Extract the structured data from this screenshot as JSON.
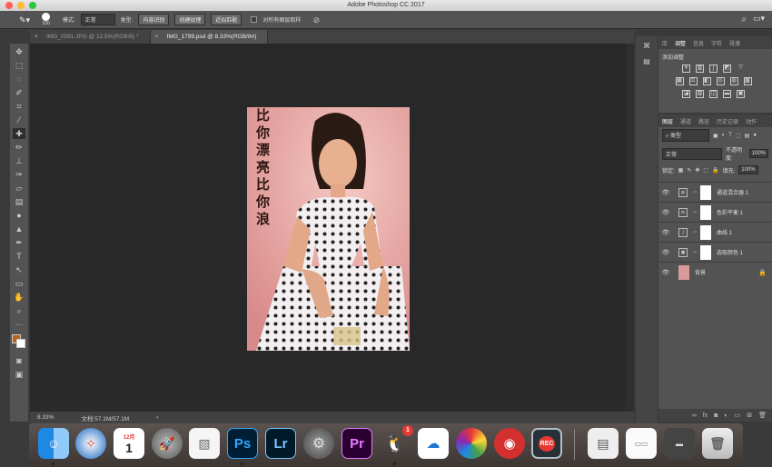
{
  "window": {
    "title": "Adobe Photoshop CC 2017"
  },
  "options": {
    "brush_size": "100",
    "mode_label": "模式:",
    "mode_value": "正常",
    "type_label": "类型:",
    "btn_content_aware": "内容识别",
    "btn_create_texture": "创建纹理",
    "btn_proximity_match": "近似匹配",
    "sample_all_layers": "对所有图层取样"
  },
  "tabs": [
    {
      "label": "IMG_0591.JPG @ 12.5%(RGB/8) *"
    },
    {
      "label": "IMG_1799.psd @ 8.33%(RGB/8#)"
    }
  ],
  "photo": {
    "text_lines": [
      "比",
      "你",
      "漂",
      "亮",
      "比",
      "你",
      "浪"
    ]
  },
  "status": {
    "zoom": "8.33%",
    "doc": "文档:57.1M/57.1M"
  },
  "right_panel": {
    "top_tabs": [
      "库",
      "调整",
      "信息",
      "字符",
      "段落"
    ],
    "adjustments_title": "添加调整",
    "layer_tabs": [
      "图层",
      "通道",
      "路径",
      "历史记录",
      "动作"
    ],
    "filter_label": "类型",
    "blend_mode": "正常",
    "opacity_label": "不透明度:",
    "opacity_value": "100%",
    "lock_label": "锁定:",
    "fill_label": "填充:",
    "fill_value": "100%",
    "layers": [
      {
        "name": "通道混合器 1",
        "icon": "channel-mixer-icon"
      },
      {
        "name": "色彩平衡 1",
        "icon": "color-balance-icon"
      },
      {
        "name": "曲线 1",
        "icon": "curves-icon"
      },
      {
        "name": "选取颜色 1",
        "icon": "selective-color-icon"
      }
    ],
    "background_layer": "背景"
  },
  "dock": {
    "calendar_month": "12月",
    "calendar_day": "1",
    "ps_label": "Ps",
    "lr_label": "Lr",
    "pr_label": "Pr",
    "qq_badge": "1",
    "rec_label": "REC"
  },
  "colors": {
    "foreground": "#b8641e",
    "background": "#ffffff",
    "panel": "#535353",
    "canvas": "#282828"
  }
}
